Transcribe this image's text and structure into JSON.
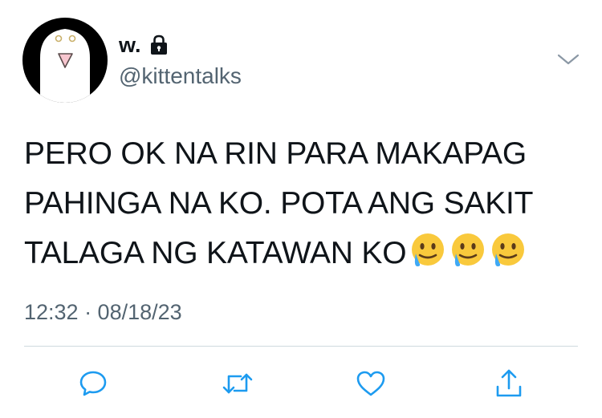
{
  "user": {
    "display_name": "w.",
    "handle": "@kittentalks",
    "locked_icon": "lock-icon",
    "avatar_icon": "ghost-avatar"
  },
  "tweet": {
    "text": "PERO OK NA RIN PARA MAKAPAG PAHINGA NA KO. POTA ANG SAKIT TALAGA NG KATAWAN KO",
    "emoji": [
      "🥲",
      "🥲",
      "🥲"
    ],
    "emoji_icon": "smiling-face-with-tear-icon",
    "timestamp": "12:32 · 08/18/23"
  },
  "actions": {
    "menu_icon": "chevron-down-icon",
    "reply_icon": "reply-icon",
    "retweet_icon": "retweet-icon",
    "like_icon": "heart-icon",
    "share_icon": "share-icon"
  },
  "colors": {
    "text": "#0f1419",
    "secondary": "#536471",
    "divider": "#cfd9de",
    "action_icon": "#1d9bf0"
  }
}
